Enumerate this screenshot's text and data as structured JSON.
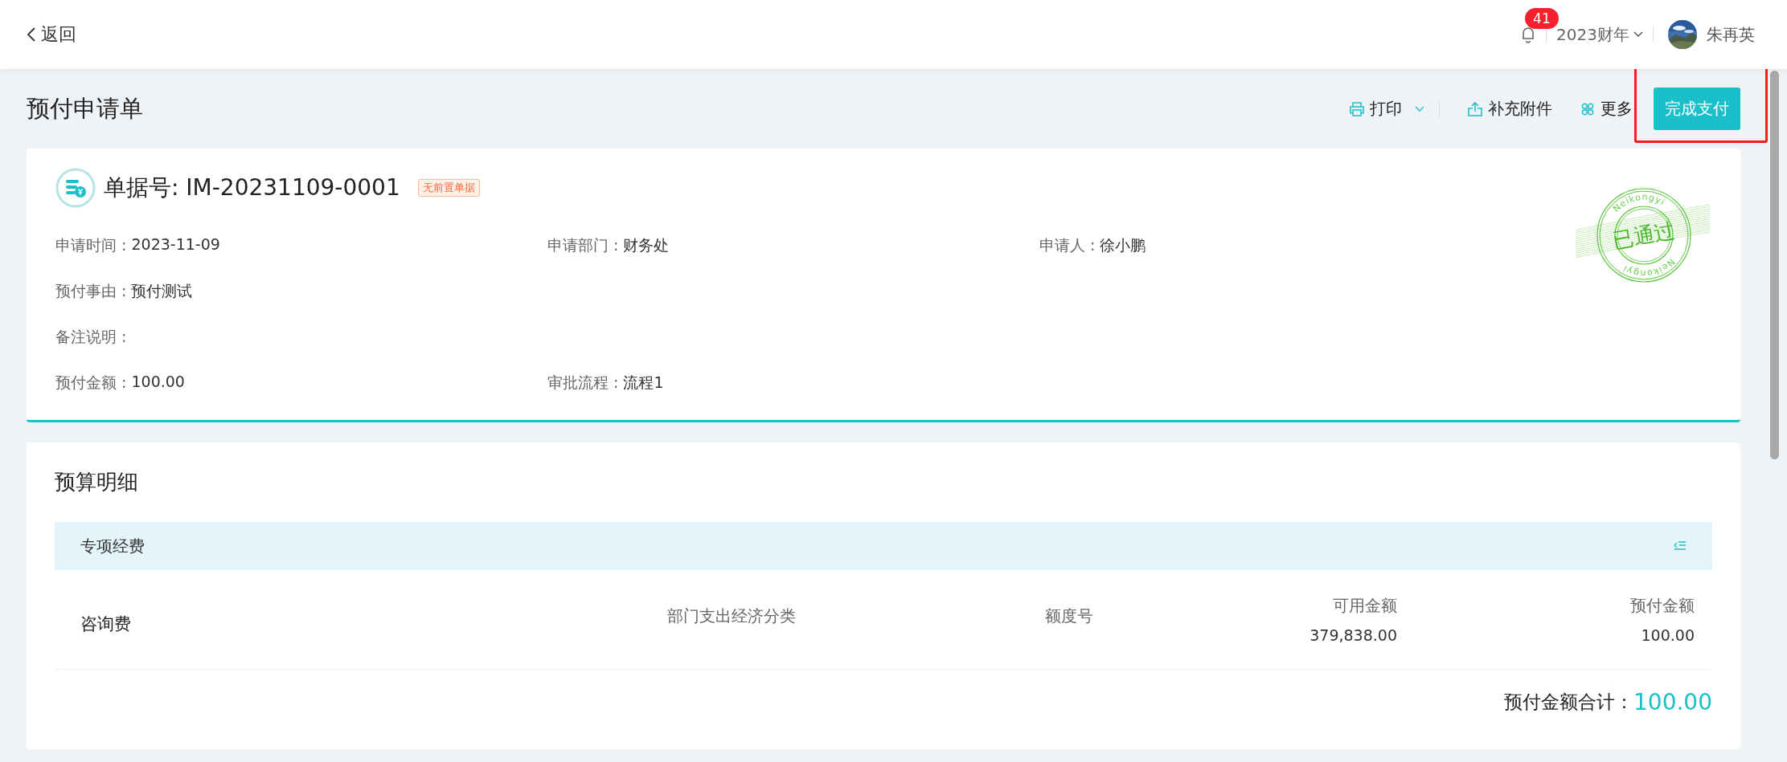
{
  "header": {
    "back": "返回",
    "notifications": {
      "badge": "41"
    },
    "fiscal_year": "2023财年",
    "user": {
      "name": "朱再英"
    }
  },
  "page": {
    "title": "预付申请单"
  },
  "toolbar": [
    {
      "kind": "print",
      "label": "打印",
      "dropdown": true
    },
    {
      "kind": "upload",
      "label": "补充附件"
    },
    {
      "kind": "more",
      "label": "更多"
    },
    {
      "kind": "primary",
      "label": "完成支付",
      "highlighted": true
    }
  ],
  "document": {
    "number": "单据号: IM-20231109-0001",
    "tag": "无前置单据",
    "rows": [
      [
        {
          "label": "申请时间 :",
          "value": "2023-11-09"
        },
        {
          "label": "申请部门 :",
          "value": "财务处"
        },
        {
          "label": "申请人 :",
          "value": "徐小鹏"
        }
      ],
      [
        {
          "label": "预付事由 :",
          "value": "预付测试"
        }
      ],
      [
        {
          "label": "备注说明 :"
        }
      ],
      [
        {
          "label": "预付金额 :",
          "value": "100.00"
        },
        {
          "label": "审批流程 :",
          "value": "流程1"
        }
      ]
    ],
    "stamp": {
      "text": "已通过",
      "ring_top": "Neikongyi",
      "ring_bottom": "Neikongyi"
    }
  },
  "budget": {
    "title": "预算明细",
    "groups": [
      {
        "name": "专项经费",
        "items": [
          {
            "name": "咨询费",
            "category": "部门支出经济分类",
            "quota_label": "额度号",
            "available_label": "可用金额",
            "available": "379,838.00",
            "prepay_label": "预付金额",
            "prepay": "100.00"
          }
        ]
      }
    ],
    "total_label": "预付金额合计：",
    "total": "100.00"
  }
}
